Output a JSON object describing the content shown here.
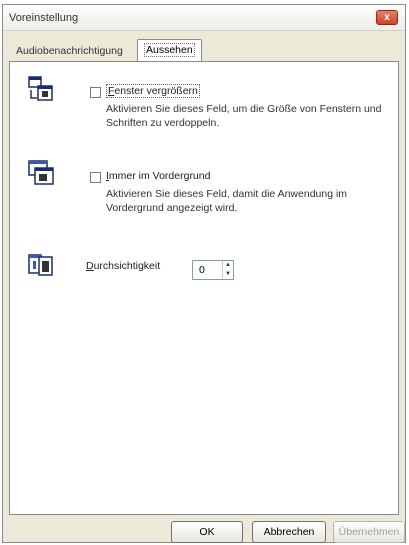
{
  "window": {
    "title": "Voreinstellung",
    "close_label": "x"
  },
  "tabs": [
    {
      "label": "Audiobenachrichtigung"
    },
    {
      "label": "Aussehen"
    }
  ],
  "options": [
    {
      "label_first": "F",
      "label_rest": "enster vergrößern",
      "checked": false,
      "description": "Aktivieren Sie dieses Feld, um die Größe von Fenstern und Schriften zu verdoppeln."
    },
    {
      "label_first": "I",
      "label_rest": "mmer im Vordergrund",
      "checked": false,
      "description": "Aktivieren Sie dieses Feld, damit die Anwendung im Vordergrund angezeigt wird."
    }
  ],
  "transparency": {
    "label_first": "D",
    "label_rest": "urchsichtigkeit",
    "value": "0"
  },
  "buttons": {
    "ok": "OK",
    "cancel": "Abbrechen",
    "apply": "Übernehmen"
  }
}
